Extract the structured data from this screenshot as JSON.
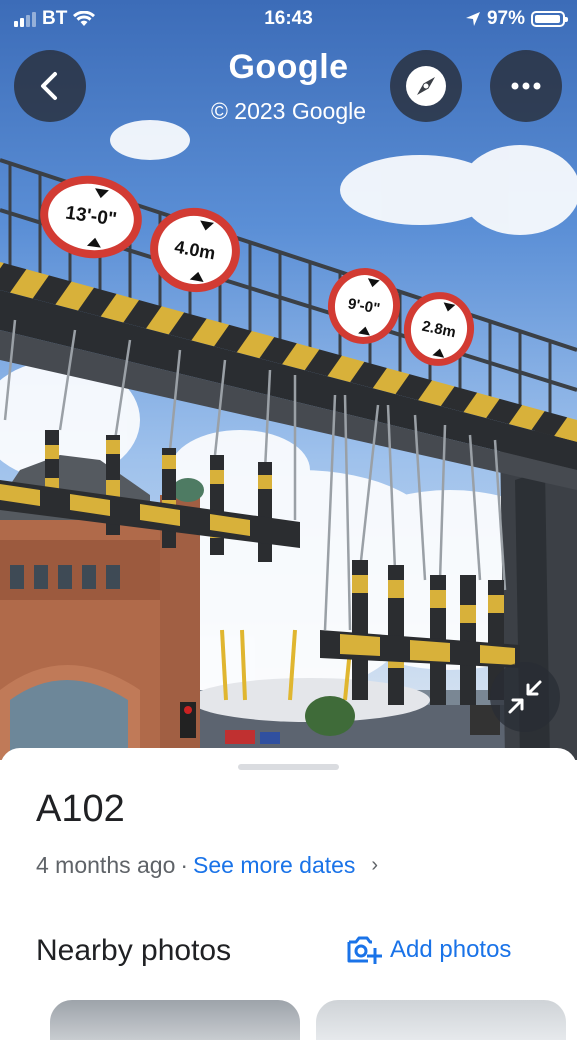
{
  "status_bar": {
    "carrier": "BT",
    "time": "16:43",
    "battery_percent": "97%",
    "battery_level": 0.97,
    "signal_bars_filled": 2,
    "signal_bars_total": 4
  },
  "header": {
    "title": "Google",
    "subtitle": "© 2023 Google",
    "back_icon": "chevron-left-icon",
    "compass_icon": "compass-icon",
    "more_icon": "more-horizontal-icon"
  },
  "photo": {
    "signs": [
      "13'-0\"",
      "4.0m",
      "9'-0\"",
      "2.8m"
    ],
    "minimize_icon": "collapse-arrows-icon"
  },
  "sheet": {
    "place_name": "A102",
    "age": "4 months ago",
    "separator": "·",
    "see_more_dates": "See more dates",
    "chevron": "›",
    "nearby_photos_title": "Nearby photos",
    "add_photos_label": "Add photos",
    "add_photos_icon": "add-photo-icon"
  },
  "colors": {
    "accent": "#1a73e8",
    "title_text": "#202124",
    "secondary_text": "#5f6368"
  }
}
